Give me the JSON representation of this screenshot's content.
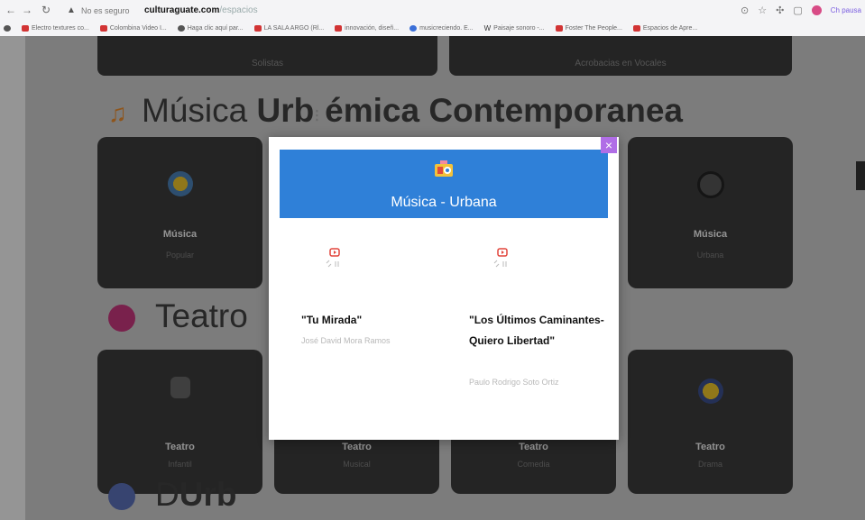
{
  "browser": {
    "insecure_label": "No es seguro",
    "url_host": "culturaguate.com",
    "url_path": "/espacios",
    "bookmarks": [
      {
        "label": "Electro textures co...",
        "favicon": "red"
      },
      {
        "label": "Colombina Video I...",
        "favicon": "red"
      },
      {
        "label": "Haga clic aquí par...",
        "favicon": "globe"
      },
      {
        "label": "LA SALA ARGO (Rl...",
        "favicon": "red"
      },
      {
        "label": "innovación, diseñ...",
        "favicon": "red"
      },
      {
        "label": "musicreciendo. E...",
        "favicon": "blue"
      },
      {
        "label": "Paisaje sonoro -...",
        "favicon": "wiki"
      },
      {
        "label": "Foster The People...",
        "favicon": "red"
      },
      {
        "label": "Espacios de Apre...",
        "favicon": "red"
      }
    ],
    "profile_label": "Ch pausa"
  },
  "page": {
    "top_cards": [
      "Solistas",
      "Acrobacias en Vocales"
    ],
    "section_musica": {
      "title_light": "Música ",
      "title_bold_1": "Urb",
      "title_bold_2": "émica Contemporanea"
    },
    "musica_cards": [
      {
        "label": "Música",
        "sub": "Popular"
      },
      {
        "label": "Música",
        "sub": "Urbana"
      }
    ],
    "section_teatro": {
      "title": "Teatro"
    },
    "teatro_cards": [
      {
        "label": "Teatro",
        "sub": "Infantil"
      },
      {
        "label": "Teatro",
        "sub": "Musical"
      },
      {
        "label": "Teatro",
        "sub": "Comedia"
      },
      {
        "label": "Teatro",
        "sub": "Drama"
      }
    ],
    "bottom_title": {
      "light": "D",
      "bold": "Urb"
    }
  },
  "modal": {
    "close_label": "×",
    "title": "Música - Urbana",
    "items": [
      {
        "name": "\"Tu Mirada\"",
        "author": "José David Mora Ramos"
      },
      {
        "name": "\"Los Últimos Caminantes-Quiero Libertad\"",
        "author": "Paulo Rodrigo Soto Ortiz"
      }
    ]
  },
  "colors": {
    "modal_header": "#2f80d8",
    "close_button": "#b06ee6",
    "card": "#3b3b3b"
  }
}
